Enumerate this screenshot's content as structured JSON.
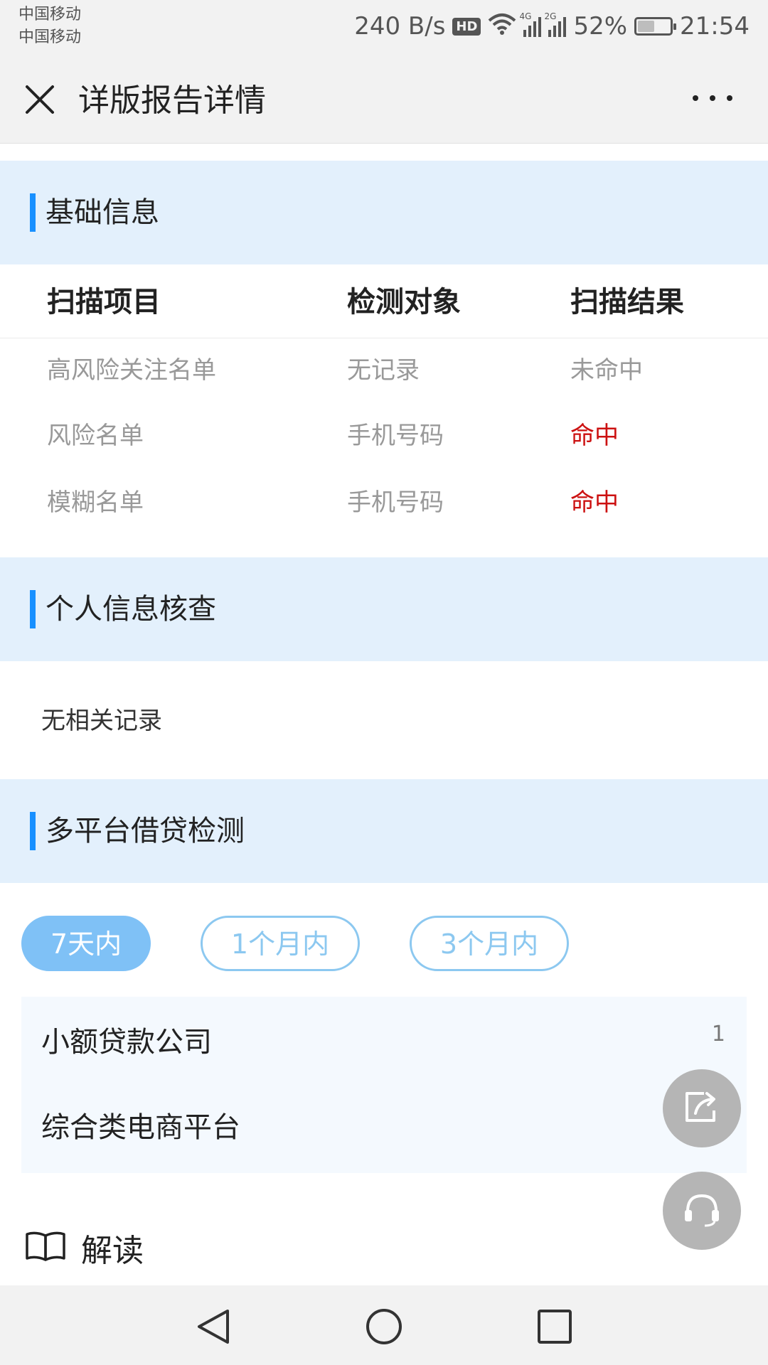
{
  "status_bar": {
    "carrier_1": "中国移动",
    "carrier_2": "中国移动",
    "net_speed": "240 B/s",
    "hd_badge": "HD",
    "signal_1_type": "4G",
    "signal_2_type": "2G",
    "battery_percent": "52%",
    "battery_level": 0.52,
    "time": "21:54"
  },
  "header": {
    "title": "详版报告详情",
    "close_icon": "close-icon",
    "more_icon": "more-icon"
  },
  "basic_info": {
    "title": "基础信息",
    "columns": [
      "扫描项目",
      "检测对象",
      "扫描结果"
    ],
    "rows": [
      {
        "item": "高风险关注名单",
        "target": "无记录",
        "result": "未命中",
        "hit": false
      },
      {
        "item": "风险名单",
        "target": "手机号码",
        "result": "命中",
        "hit": true
      },
      {
        "item": "模糊名单",
        "target": "手机号码",
        "result": "命中",
        "hit": true
      }
    ],
    "hit_color": "#cc1111"
  },
  "personal_check": {
    "title": "个人信息核查",
    "empty_text": "无相关记录"
  },
  "multi_platform": {
    "title": "多平台借贷检测",
    "tabs": [
      {
        "label": "7天内",
        "active": true
      },
      {
        "label": "1个月内",
        "active": false
      },
      {
        "label": "3个月内",
        "active": false
      }
    ],
    "items": [
      {
        "label": "小额贷款公司",
        "count": "1"
      },
      {
        "label": "综合类电商平台",
        "count": ""
      }
    ]
  },
  "interpretation": {
    "label": "解读",
    "icon": "book-icon"
  },
  "floating": {
    "share_icon": "share-icon",
    "support_icon": "headset-icon"
  },
  "nav": {
    "back_icon": "back-triangle-icon",
    "home_icon": "home-circle-icon",
    "recents_icon": "recents-square-icon"
  },
  "colors": {
    "accent": "#1890ff",
    "section_bg": "#e3f0fc",
    "tab_active": "#7fc1f6",
    "tab_border": "#8cc8f0"
  }
}
